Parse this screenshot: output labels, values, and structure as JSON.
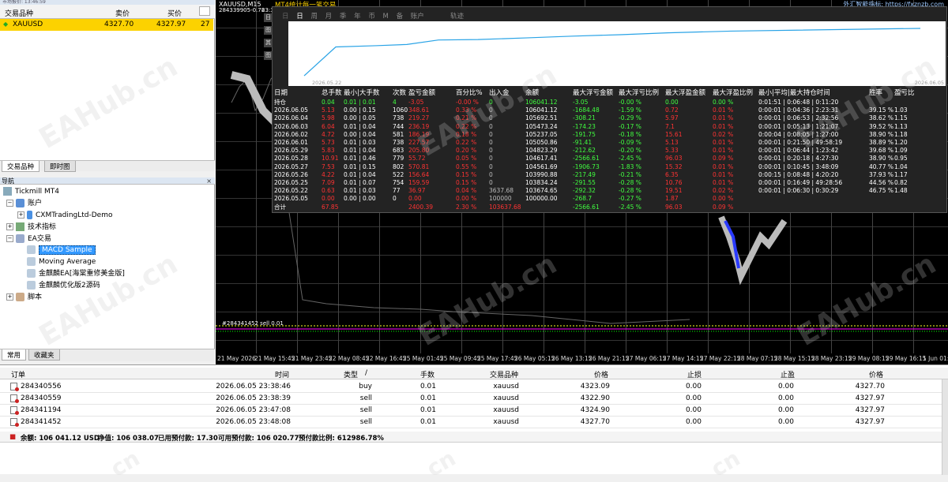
{
  "market_watch": {
    "title": "市场报价: 13:46:59",
    "col_symbol": "交易品种",
    "col_bid": "卖价",
    "col_ask": "买价",
    "row": {
      "symbol": "XAUUSD",
      "bid": "4327.70",
      "ask": "4327.97",
      "spread": "27"
    },
    "tabs": [
      "交易品种",
      "即时图"
    ]
  },
  "navigator": {
    "title": "导航",
    "close": "×",
    "tree": [
      "Tickmill MT4",
      "账户",
      "CXMTradingLtd-Demo",
      "技术指标",
      "EA交易",
      "MACD Sample",
      "Moving Average",
      "金麒麟EA[海棠重修美金版]",
      "金麒麟优化版2源码",
      "脚本"
    ],
    "tabs": [
      "常用",
      "收藏夹"
    ]
  },
  "chart": {
    "symbol": "XAUUSD,M15",
    "info": "284339905-0.78",
    "clock": "23:38:33",
    "panel_title": "MT4统计每一笔交易",
    "indicator": "外汇智能指标: https://fxznzb.com",
    "panel_tabs": [
      "日",
      "周",
      "月",
      "季",
      "年",
      "币",
      "M",
      "备",
      "账户"
    ],
    "panel_tab_prefix": "日",
    "trail": "轨迹",
    "sparkline_start": "2026.05.22",
    "sparkline_end": "2026.06.05",
    "side_buttons": [
      "日",
      "图",
      "其",
      "图"
    ],
    "order_line": "#284341452 sell 0.01",
    "time_axis": [
      "21 May 2026",
      "21 May 15:45",
      "21 May 23:45",
      "22 May 08:45",
      "22 May 16:45",
      "25 May 01:45",
      "25 May 09:45",
      "25 May 17:45",
      "26 May 05:15",
      "26 May 13:15",
      "26 May 21:15",
      "27 May 06:15",
      "27 May 14:15",
      "27 May 22:15",
      "28 May 07:15",
      "28 May 15:15",
      "28 May 23:15",
      "29 May 08:15",
      "29 May 16:15",
      "1 Jun 01:"
    ],
    "watermark": "EAHub.cn",
    "watermark_short": "cn"
  },
  "stats": {
    "headers": [
      "日期",
      "总手数",
      "最小|大手数",
      "次数",
      "盈亏金额",
      "百分比%",
      "出入金",
      "余额",
      "最大浮亏金额",
      "最大浮亏比例",
      "最大浮盈金额",
      "最大浮盈比例",
      "最小|平均|最大持仓时间",
      "胜率",
      "盈亏比"
    ],
    "rows": [
      [
        "持仓",
        "0.04",
        "0.01 | 0.01",
        "4",
        "-3.05",
        "-0.00 %",
        "0",
        "106041.12",
        "-3.05",
        "-0.00 %",
        "0.00",
        "0.00 %",
        "0:01:51 | 0:06:48 | 0:11:20",
        "",
        ""
      ],
      [
        "2026.06.05",
        "5.13",
        "0.00 | 0.15",
        "1060",
        "348.61",
        "0.33 %",
        "0",
        "106041.12",
        "-1684.48",
        "-1.59 %",
        "0.72",
        "0.01 %",
        "0:00:01 | 0:04:36 | 2:23:31",
        "39.15 %",
        "1.03"
      ],
      [
        "2026.06.04",
        "5.98",
        "0.00 | 0.05",
        "738",
        "219.27",
        "0.21 %",
        "0",
        "105692.51",
        "-308.21",
        "-0.29 %",
        "5.97",
        "0.01 %",
        "0:00:01 | 0:06:53 | 2:32:56",
        "38.62 %",
        "1.15"
      ],
      [
        "2026.06.03",
        "6.04",
        "0.01 | 0.04",
        "744",
        "236.19",
        "0.22 %",
        "0",
        "105473.24",
        "-174.23",
        "-0.17 %",
        "7.1",
        "0.01 %",
        "0:00:01 | 0:05:13 | 1:21:07",
        "39.52 %",
        "1.13"
      ],
      [
        "2026.06.02",
        "4.72",
        "0.00 | 0.04",
        "581",
        "186.19",
        "0.18 %",
        "0",
        "105237.05",
        "-191.75",
        "-0.18 %",
        "15.61",
        "0.02 %",
        "0:00:04 | 0:08:05 | 1:27:00",
        "38.90 %",
        "1.18"
      ],
      [
        "2026.06.01",
        "5.73",
        "0.01 | 0.03",
        "738",
        "227.57",
        "0.22 %",
        "0",
        "105050.86",
        "-91.41",
        "-0.09 %",
        "5.13",
        "0.01 %",
        "0:00:01 | 0:21:50 | 49:58:19",
        "38.89 %",
        "1.20"
      ],
      [
        "2026.05.29",
        "5.83",
        "0.01 | 0.04",
        "683",
        "205.80",
        "0.20 %",
        "0",
        "104823.29",
        "-212.62",
        "-0.20 %",
        "5.33",
        "0.01 %",
        "0:00:01 | 0:06:44 | 1:23:42",
        "39.68 %",
        "1.09"
      ],
      [
        "2026.05.28",
        "10.91",
        "0.01 | 0.46",
        "779",
        "55.72",
        "0.05 %",
        "0",
        "104617.41",
        "-2566.61",
        "-2.45 %",
        "96.03",
        "0.09 %",
        "0:00:01 | 0:20:18 | 4:27:30",
        "38.90 %",
        "0.95"
      ],
      [
        "2026.05.27",
        "7.53",
        "0.01 | 0.15",
        "802",
        "570.81",
        "0.55 %",
        "0",
        "104561.69",
        "-1906.73",
        "-1.83 %",
        "15.32",
        "0.01 %",
        "0:00:01 | 0:10:45 | 3:48:09",
        "40.77 %",
        "1.04"
      ],
      [
        "2026.05.26",
        "4.22",
        "0.01 | 0.04",
        "522",
        "156.64",
        "0.15 %",
        "0",
        "103990.88",
        "-217.49",
        "-0.21 %",
        "6.35",
        "0.01 %",
        "0:00:15 | 0:08:48 | 4:20:20",
        "37.93 %",
        "1.17"
      ],
      [
        "2026.05.25",
        "7.09",
        "0.01 | 0.07",
        "754",
        "159.59",
        "0.15 %",
        "0",
        "103834.24",
        "-291.55",
        "-0.28 %",
        "10.76",
        "0.01 %",
        "0:00:01 | 0:16:49 | 49:28:56",
        "44.56 %",
        "0.82"
      ],
      [
        "2026.05.22",
        "0.63",
        "0.01 | 0.03",
        "77",
        "36.97",
        "0.04 %",
        "3637.68",
        "103674.65",
        "-292.32",
        "-0.28 %",
        "19.51",
        "0.02 %",
        "0:00:01 | 0:06:30 | 0:30:29",
        "46.75 %",
        "1.48"
      ],
      [
        "2026.05.05",
        "0.00",
        "0.00 | 0.00",
        "0",
        "0.00",
        "0.00 %",
        "100000",
        "100000.00",
        "-268.7",
        "-0.27 %",
        "1.87",
        "0.00 %",
        "",
        "",
        ""
      ],
      [
        "合计",
        "67.85",
        "",
        "",
        "2400.39",
        "2.30 %",
        "103637.68",
        "",
        "-2566.61",
        "-2.45 %",
        "96.03",
        "0.09 %",
        "",
        "",
        ""
      ]
    ]
  },
  "orders": {
    "headers": [
      "订单",
      "时间",
      "类型",
      "/",
      "手数",
      "交易品种",
      "价格",
      "止损",
      "止盈",
      "价格"
    ],
    "rows": [
      [
        "284340556",
        "2026.06.05 23:38:46",
        "buy",
        "0.01",
        "xauusd",
        "4323.09",
        "0.00",
        "0.00",
        "4327.70"
      ],
      [
        "284340559",
        "2026.06.05 23:38:39",
        "sell",
        "0.01",
        "xauusd",
        "4322.90",
        "0.00",
        "0.00",
        "4327.97"
      ],
      [
        "284341194",
        "2026.06.05 23:47:08",
        "sell",
        "0.01",
        "xauusd",
        "4324.90",
        "0.00",
        "0.00",
        "4327.97"
      ],
      [
        "284341452",
        "2026.06.05 23:48:08",
        "sell",
        "0.01",
        "xauusd",
        "4327.70",
        "0.00",
        "0.00",
        "4327.97"
      ]
    ],
    "balance": {
      "b": "余额: 106 041.12 USD",
      "e": "净值: 106 038.07",
      "m": "已用预付款: 17.30",
      "f": "可用预付款: 106 020.77",
      "l": "预付款比例: 612986.78%"
    }
  },
  "equity_curve": [
    100000,
    103674.65,
    103834.24,
    103990.88,
    104561.69,
    104617.41,
    104823.29,
    105050.86,
    105237.05,
    105473.24,
    105692.51,
    106041.12
  ],
  "colors": {
    "highlight": "#fcd200",
    "green": "#40ff40",
    "red": "#ff3333",
    "curve": "#29a3e6"
  }
}
